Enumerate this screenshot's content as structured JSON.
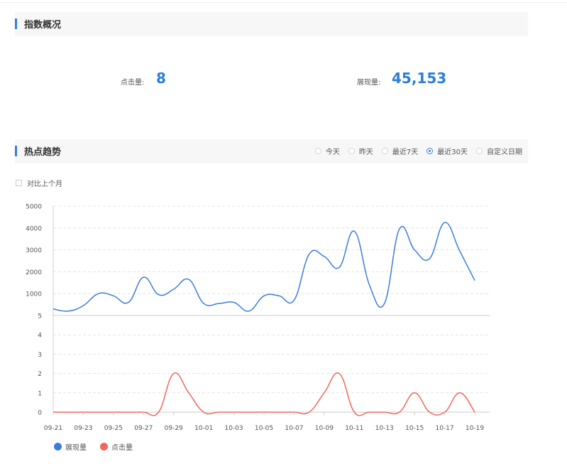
{
  "overview": {
    "title": "指数概况",
    "clicks_label": "点击量:",
    "clicks_value": "8",
    "impressions_label": "展现量:",
    "impressions_value": "45,153"
  },
  "trend": {
    "title": "热点趋势",
    "range_options": [
      {
        "label": "今天",
        "selected": false
      },
      {
        "label": "昨天",
        "selected": false
      },
      {
        "label": "最近7天",
        "selected": false
      },
      {
        "label": "最近30天",
        "selected": true
      },
      {
        "label": "自定义日期",
        "selected": false
      }
    ],
    "compare_label": "对比上个月",
    "compare_checked": false
  },
  "colors": {
    "accent": "#3b7ddd",
    "impressions_line": "#3b7ddd",
    "clicks_line": "#f2675b",
    "value_text": "#2a7fd7"
  },
  "chart_data": {
    "type": "line",
    "x": [
      "09-21",
      "09-22",
      "09-23",
      "09-24",
      "09-25",
      "09-26",
      "09-27",
      "09-28",
      "09-29",
      "09-30",
      "10-01",
      "10-02",
      "10-03",
      "10-04",
      "10-05",
      "10-06",
      "10-07",
      "10-08",
      "10-09",
      "10-10",
      "10-11",
      "10-12",
      "10-13",
      "10-14",
      "10-15",
      "10-16",
      "10-17",
      "10-18",
      "10-19"
    ],
    "x_tick_labels": [
      "09-21",
      "09-23",
      "09-25",
      "09-27",
      "09-29",
      "10-01",
      "10-03",
      "10-05",
      "10-07",
      "10-09",
      "10-11",
      "10-13",
      "10-15",
      "10-17",
      "10-19"
    ],
    "grid": true,
    "legend_position": "bottom-left",
    "panels": [
      {
        "name": "展现量",
        "ylim": [
          0,
          5000
        ],
        "yticks": [
          "1000",
          "2000",
          "3000",
          "4000",
          "5000"
        ],
        "series": [
          {
            "name": "展现量",
            "color": "#3b7ddd",
            "values": [
              300,
              200,
              450,
              1000,
              900,
              600,
              1750,
              950,
              1200,
              1650,
              550,
              550,
              600,
              200,
              900,
              900,
              700,
              2800,
              2700,
              2200,
              3850,
              1400,
              550,
              3950,
              3000,
              2600,
              4250,
              2950,
              1600
            ]
          }
        ]
      },
      {
        "name": "点击量",
        "ylim": [
          0,
          5
        ],
        "yticks": [
          "0",
          "1",
          "2",
          "3",
          "4",
          "5"
        ],
        "series": [
          {
            "name": "点击量",
            "color": "#f2675b",
            "values": [
              0,
              0,
              0,
              0,
              0,
              0,
              0,
              0,
              2,
              1,
              0,
              0,
              0,
              0,
              0,
              0,
              0,
              0,
              1,
              2,
              0,
              0,
              0,
              0,
              1,
              0,
              0,
              1,
              0
            ]
          }
        ]
      }
    ]
  }
}
